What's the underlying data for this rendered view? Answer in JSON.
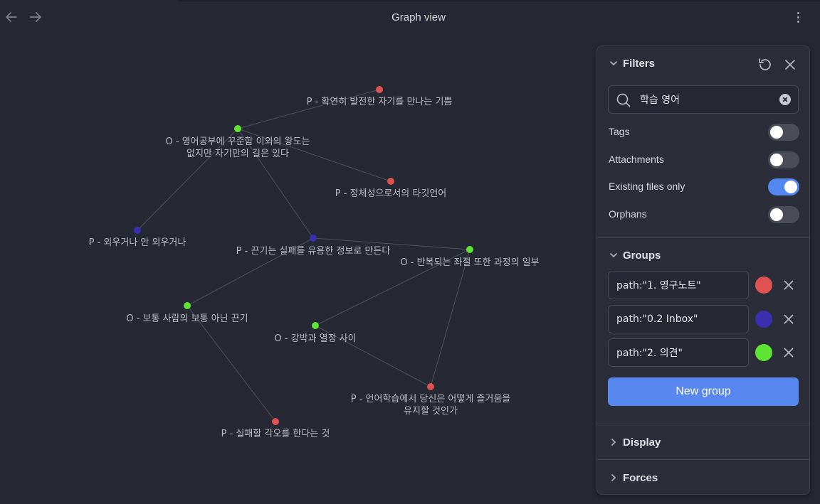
{
  "header": {
    "title": "Graph view"
  },
  "graph": {
    "nodes": [
      {
        "label": "P - 확연히 발전한 자기를 만나는 기쁨",
        "color": "#e05252"
      },
      {
        "label": "O - 영어공부에 꾸준함 이외의 왕도는",
        "label2": "없지만 자기만의 길은 있다",
        "color": "#5ee435"
      },
      {
        "label": "P - 정체성으로서의 타깃언어",
        "color": "#e05252"
      },
      {
        "label": "P - 외우거나 안 외우거나",
        "color": "#3b2fb0"
      },
      {
        "label": "P - 끈기는 실패를 유용한 정보로 만든다",
        "color": "#3b2fb0"
      },
      {
        "label": "O - 반복되는 좌절 또한 과정의 일부",
        "color": "#5ee435"
      },
      {
        "label": "O - 보통 사람의 보통 아닌 끈기",
        "color": "#5ee435"
      },
      {
        "label": "O - 강박과 열정 사이",
        "color": "#5ee435"
      },
      {
        "label": "P - 언어학습에서 당신은 어떻게 즐거움을",
        "label2": "유지할 것인가",
        "color": "#e05252"
      },
      {
        "label": "P - 실패할 각오를 한다는 것",
        "color": "#e05252"
      }
    ],
    "edges": [
      [
        0,
        1
      ],
      [
        1,
        2
      ],
      [
        1,
        3
      ],
      [
        1,
        4
      ],
      [
        4,
        5
      ],
      [
        4,
        6
      ],
      [
        5,
        7
      ],
      [
        5,
        8
      ],
      [
        7,
        8
      ],
      [
        6,
        9
      ]
    ]
  },
  "filters": {
    "title": "Filters",
    "search_value": "학습 영어",
    "toggles": [
      {
        "label": "Tags",
        "on": false
      },
      {
        "label": "Attachments",
        "on": false
      },
      {
        "label": "Existing files only",
        "on": true
      },
      {
        "label": "Orphans",
        "on": false
      }
    ]
  },
  "groups": {
    "title": "Groups",
    "items": [
      {
        "query": "path:\"1. 영구노트\"",
        "color": "#e05252"
      },
      {
        "query": "path:\"0.2 Inbox\"",
        "color": "#3b2fb0"
      },
      {
        "query": "path:\"2. 의견\"",
        "color": "#5ee435"
      }
    ],
    "new_group_label": "New group"
  },
  "display": {
    "title": "Display"
  },
  "forces": {
    "title": "Forces"
  },
  "colors": {
    "accent": "#5787ef",
    "background": "#262933",
    "panel": "#2b2e38",
    "edge": "#4f525b"
  }
}
